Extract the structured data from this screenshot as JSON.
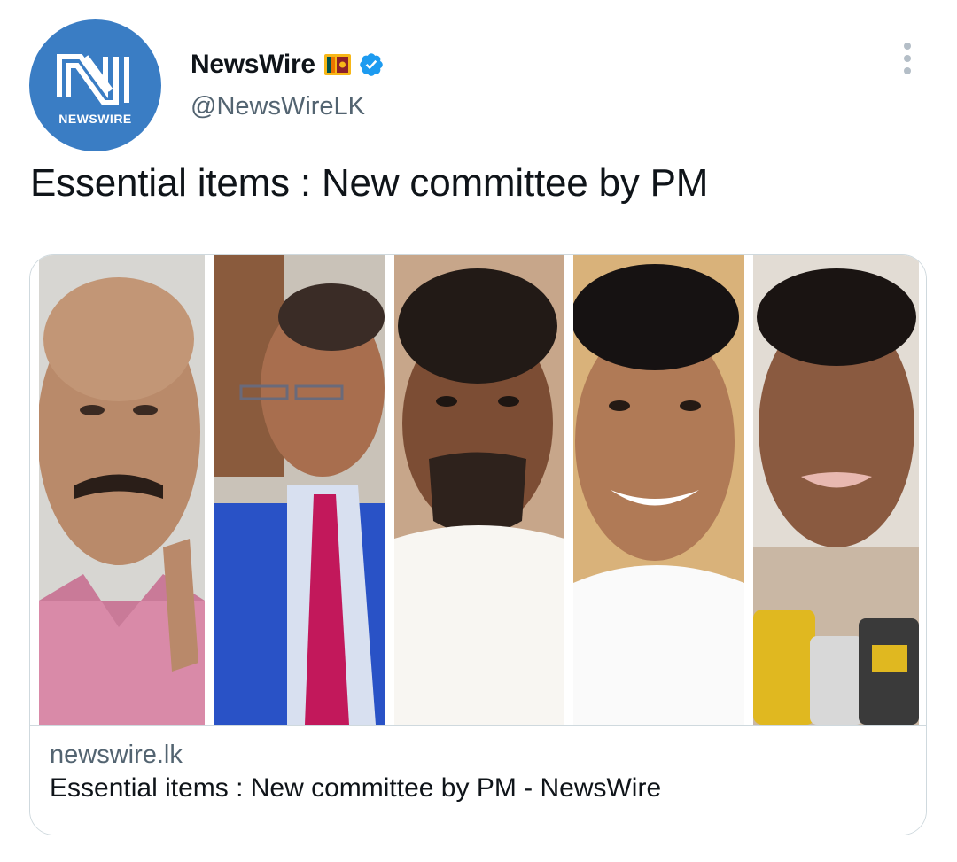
{
  "account": {
    "display_name": "NewsWire",
    "handle": "@NewsWireLK",
    "avatar_text": "NEWSWIRE",
    "flag_icon": "sri-lanka-flag-icon",
    "verified_icon": "verified-badge-icon",
    "brand_color": "#3a7dc4",
    "verified_color": "#1d9bf0"
  },
  "tweet": {
    "text": "Essential items : New committee by PM",
    "more_icon": "more-options-icon"
  },
  "link_card": {
    "domain": "newswire.lk",
    "title": "Essential items : New committee by PM - NewsWire",
    "image_panels": 5
  }
}
